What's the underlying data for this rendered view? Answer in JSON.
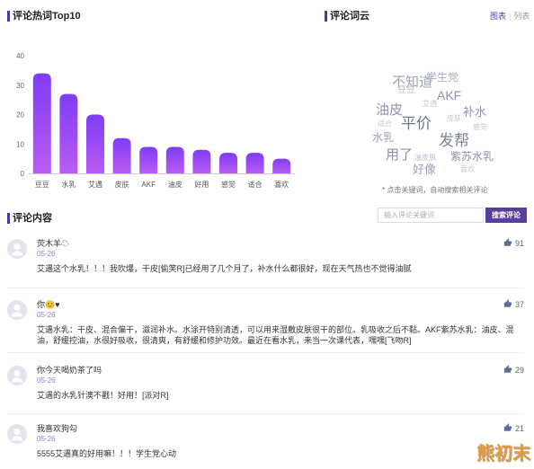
{
  "chart_data": {
    "type": "bar",
    "title": "评论热词Top10",
    "xlabel": "",
    "ylabel": "",
    "categories": [
      "豆豆",
      "水乳",
      "艾遇",
      "皮肤",
      "AKF",
      "油皮",
      "好用",
      "感觉",
      "适合",
      "喜欢"
    ],
    "values": [
      34,
      27,
      20,
      12,
      9,
      9,
      8,
      7,
      7,
      5
    ],
    "ylim": [
      0,
      40
    ],
    "yticks": [
      0,
      10,
      20,
      30,
      40
    ],
    "grid": false,
    "legend": "none"
  },
  "word_cloud": {
    "title": "评论词云",
    "view_toggle": {
      "chart": "图表",
      "separator": "|",
      "list": "列表"
    },
    "words": [
      "不知道",
      "学生党",
      "豆豆",
      "AKF",
      "油皮",
      "补水",
      "平价",
      "水乳",
      "发帮",
      "用了",
      "紫苏水乳",
      "好像",
      "油皮肌",
      "艾遇",
      "皮肤",
      "感觉",
      "适合",
      "喜欢"
    ],
    "hint": "* 点击关键词，自动搜索相关评论"
  },
  "comments_section": {
    "title": "评论内容",
    "search": {
      "placeholder": "输入评论关键词",
      "button_label": "搜索评论"
    },
    "comments": [
      {
        "name": "荧木羊☁",
        "date": "05-26",
        "likes": "91",
        "text": "艾遇这个水乳！！！我吹爆，干皮[偷笑R]已经用了几个月了，补水什么都很好，现在天气热也不觉得油腻"
      },
      {
        "name": "你😊♥",
        "date": "05-26",
        "likes": "37",
        "text": "艾遇水乳：干皮、混合偏干，滋润补水。水涂开特别清透，可以用来湿敷皮肤很干的部位。乳吸收之后不黏。AKF紫苏水乳：油皮、混油，舒缓控油，水很好吸收，很清爽，有舒缓和修护功效。最近在看水乳，来当一次课代表，嘿嘿[飞吻R]"
      },
      {
        "name": "你今天喝奶茶了吗",
        "date": "05-26",
        "likes": "29",
        "text": "艾遇的水乳针澳不戳！好用！[派对R]"
      },
      {
        "name": "我喜欢狗勾",
        "date": "05-26",
        "likes": "21",
        "text": "5555艾遇真的好用嘛！！！学生党心动"
      }
    ]
  },
  "watermark": {
    "text": "熊初末"
  },
  "icons": {
    "like": "thumbs-up-icon",
    "avatar": "user-avatar-icon"
  },
  "colors": {
    "accent": "#4b3a9e",
    "search_button": "#5a3e9f",
    "tab_active": "#5b3fa6",
    "bar_top": "#7f3cf6",
    "bar_bottom": "#b95cf3",
    "like_icon": "#5b6f95",
    "date_text": "#8e82bf"
  }
}
